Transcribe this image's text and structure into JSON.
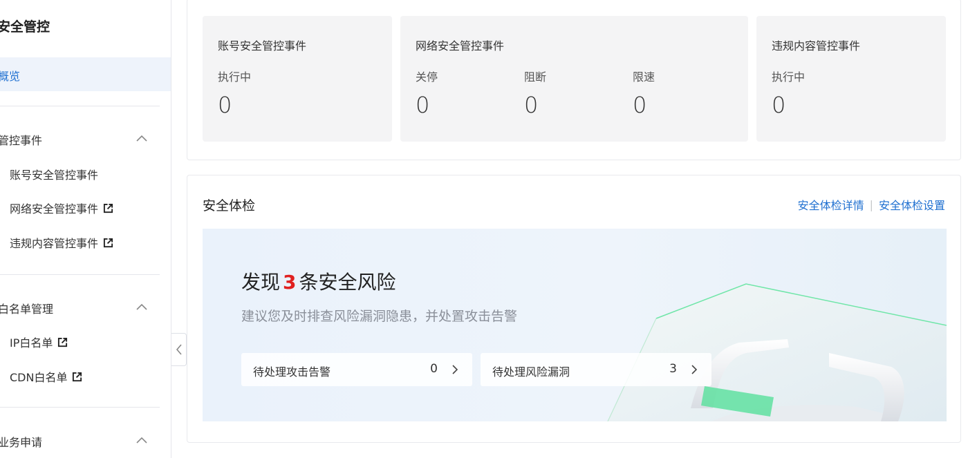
{
  "sidebar": {
    "title": "安全管控",
    "overview": "概览",
    "groups": [
      {
        "label": "管控事件",
        "items": [
          {
            "label": "账号安全管控事件",
            "external": false
          },
          {
            "label": "网络安全管控事件",
            "external": true
          },
          {
            "label": "违规内容管控事件",
            "external": true
          }
        ]
      },
      {
        "label": "白名单管理",
        "items": [
          {
            "label": "IP白名单",
            "external": true
          },
          {
            "label": "CDN白名单",
            "external": true
          }
        ]
      },
      {
        "label": "业务申请",
        "items": []
      }
    ]
  },
  "stats": {
    "account": {
      "title": "账号安全管控事件",
      "label": "执行中",
      "value": "0"
    },
    "network": {
      "title": "网络安全管控事件",
      "items": [
        {
          "label": "关停",
          "value": "0"
        },
        {
          "label": "阻断",
          "value": "0"
        },
        {
          "label": "限速",
          "value": "0"
        }
      ]
    },
    "content": {
      "title": "违规内容管控事件",
      "label": "执行中",
      "value": "0"
    }
  },
  "security_check": {
    "title": "安全体检",
    "link_details": "安全体检详情",
    "link_separator": "|",
    "link_settings": "安全体检设置",
    "headline_prefix": "发现",
    "risk_count": "3",
    "headline_suffix": "条安全风险",
    "subtitle": "建议您及时排查风险漏洞隐患，并处置攻击告警",
    "pending": [
      {
        "label": "待处理攻击告警",
        "count": "0"
      },
      {
        "label": "待处理风险漏洞",
        "count": "3"
      }
    ]
  },
  "colors": {
    "accent": "#1e6fd0",
    "risk": "#e02020",
    "green": "#5fe0a0"
  }
}
